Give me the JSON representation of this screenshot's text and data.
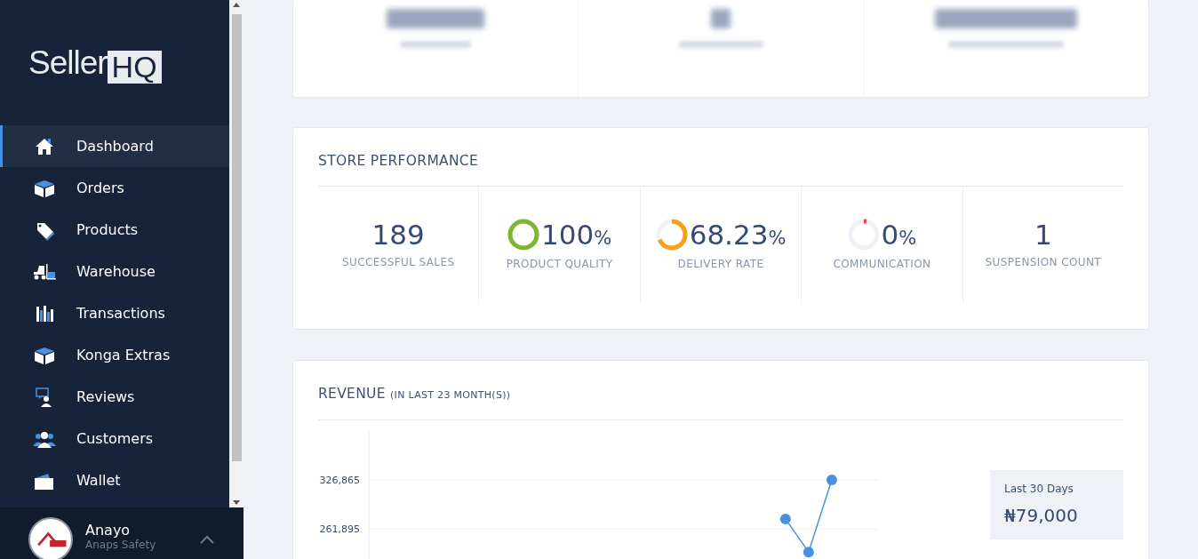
{
  "sidebar": {
    "logo": {
      "word": "Seller",
      "box": "HQ"
    },
    "items": [
      {
        "label": "Dashboard",
        "selected": true
      },
      {
        "label": "Orders",
        "selected": false
      },
      {
        "label": "Products",
        "selected": false
      },
      {
        "label": "Warehouse",
        "selected": false
      },
      {
        "label": "Transactions",
        "selected": false
      },
      {
        "label": "Konga Extras",
        "selected": false
      },
      {
        "label": "Reviews",
        "selected": false
      },
      {
        "label": "Customers",
        "selected": false
      },
      {
        "label": "Wallet",
        "selected": false
      }
    ],
    "user": {
      "name": "Anayo",
      "store": "Anaps Safety"
    }
  },
  "store_performance": {
    "title": "STORE PERFORMANCE",
    "metrics": [
      {
        "kind": "plain",
        "value": "189",
        "label": "SUCCESSFUL SALES"
      },
      {
        "kind": "ring",
        "value": "100",
        "unit": "%",
        "label": "PRODUCT QUALITY",
        "level": 1,
        "color": "#7cb82f"
      },
      {
        "kind": "ring",
        "value": "68.23",
        "unit": "%",
        "label": "DELIVERY RATE",
        "level": 0.6823,
        "color": "#f5a01a"
      },
      {
        "kind": "ring",
        "value": "0",
        "unit": "%",
        "label": "COMMUNICATION",
        "level": 0,
        "color": "#e0474c"
      },
      {
        "kind": "plain",
        "value": "1",
        "label": "SUSPENSION COUNT"
      }
    ]
  },
  "revenue": {
    "title": "REVENUE",
    "subtitle": "(IN LAST 23 MONTH(S))",
    "chart_data": {
      "type": "line",
      "ylim": [
        217000,
        391800
      ],
      "yticks": [
        {
          "value": 261895,
          "label": "261,895"
        },
        {
          "value": 326865,
          "label": "326,865"
        }
      ],
      "series": [
        {
          "color": "#4a90e2",
          "marker": "circle",
          "values": [
            null,
            null,
            null,
            null,
            null,
            null,
            null,
            null,
            null,
            null,
            null,
            null,
            null,
            null,
            null,
            null,
            null,
            null,
            275000,
            231000,
            326865,
            null,
            null
          ]
        }
      ]
    },
    "summary": {
      "label": "Last 30 Days",
      "amount": "₦79,000"
    }
  }
}
